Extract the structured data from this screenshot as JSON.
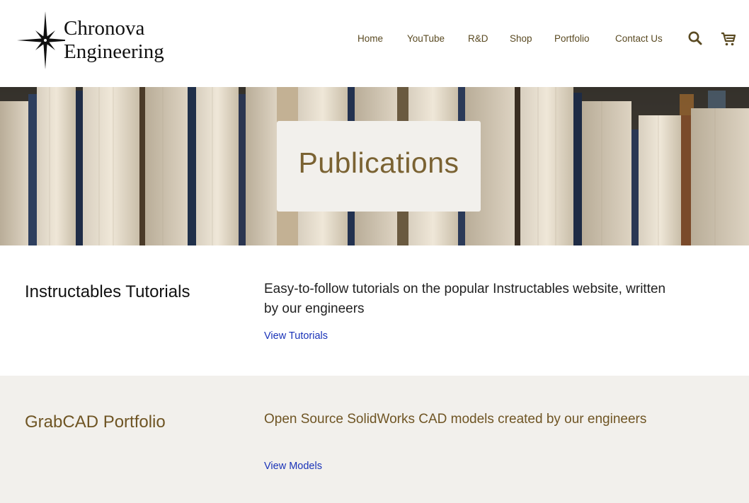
{
  "header": {
    "logo_line1": "Chronova",
    "logo_line2": "Engineering",
    "nav": [
      "Home",
      "YouTube",
      "R&D",
      "Shop",
      "Portfolio",
      "Contact Us"
    ],
    "icons": [
      "search-icon",
      "cart-icon"
    ]
  },
  "hero": {
    "title": "Publications"
  },
  "sections": [
    {
      "title": "Instructables Tutorials",
      "description": "Easy-to-follow tutorials on the popular Instructables website, written by our engineers",
      "link": "View Tutorials"
    },
    {
      "title": "GrabCAD Portfolio",
      "description": "Open Source SolidWorks CAD models created by our engineers",
      "link": "View Models"
    }
  ],
  "colors": {
    "accent": "#6f5524",
    "link": "#1a33b8",
    "alt_background": "#f2f0ec"
  }
}
